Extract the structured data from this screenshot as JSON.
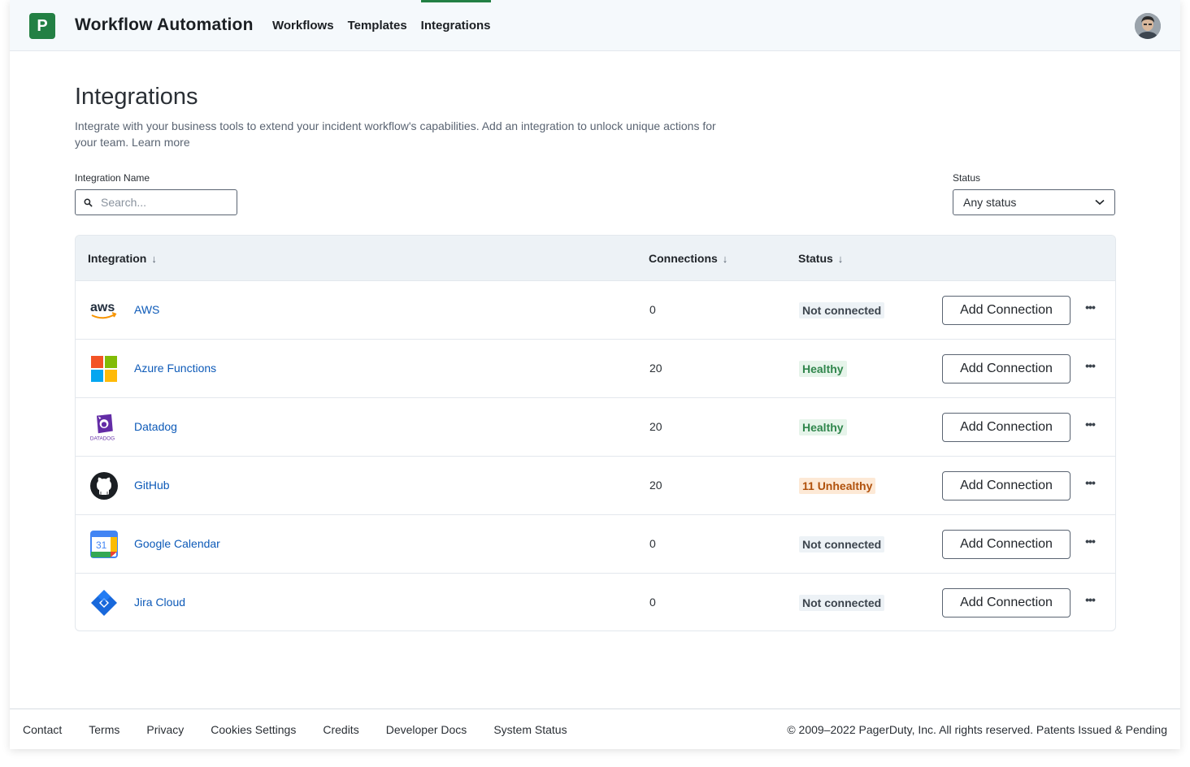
{
  "header": {
    "logo_letter": "P",
    "app_title": "Workflow Automation",
    "nav": [
      {
        "label": "Workflows",
        "active": false
      },
      {
        "label": "Templates",
        "active": false
      },
      {
        "label": "Integrations",
        "active": true
      }
    ]
  },
  "page": {
    "title": "Integrations",
    "description": "Integrate with your business tools to extend your incident workflow's capabilities. Add an integration to unlock unique actions for your team. Learn more"
  },
  "filters": {
    "name_label": "Integration Name",
    "search_placeholder": "Search...",
    "status_label": "Status",
    "status_value": "Any status"
  },
  "table": {
    "headers": {
      "integration": "Integration",
      "connections": "Connections",
      "status": "Status"
    },
    "rows": [
      {
        "name": "AWS",
        "icon": "aws-logo-icon",
        "connections": "0",
        "status": "Not connected",
        "status_type": "not-connected",
        "action": "Add Connection"
      },
      {
        "name": "Azure Functions",
        "icon": "microsoft-logo-icon",
        "connections": "20",
        "status": "Healthy",
        "status_type": "healthy",
        "action": "Add Connection"
      },
      {
        "name": "Datadog",
        "icon": "datadog-logo-icon",
        "connections": "20",
        "status": "Healthy",
        "status_type": "healthy",
        "action": "Add Connection"
      },
      {
        "name": "GitHub",
        "icon": "github-logo-icon",
        "connections": "20",
        "status": "11 Unhealthy",
        "status_type": "unhealthy",
        "action": "Add Connection"
      },
      {
        "name": "Google Calendar",
        "icon": "google-calendar-logo-icon",
        "connections": "0",
        "status": "Not connected",
        "status_type": "not-connected",
        "action": "Add Connection"
      },
      {
        "name": "Jira Cloud",
        "icon": "jira-logo-icon",
        "connections": "0",
        "status": "Not connected",
        "status_type": "not-connected",
        "action": "Add Connection"
      }
    ]
  },
  "footer": {
    "links": [
      "Contact",
      "Terms",
      "Privacy",
      "Cookies Settings",
      "Credits",
      "Developer Docs",
      "System Status"
    ],
    "copyright": "© 2009–2022 PagerDuty, Inc. All rights reserved. Patents Issued & Pending"
  },
  "colors": {
    "brand": "#238044",
    "link": "#0d5ab8",
    "healthy_bg": "#e6f4ea",
    "unhealthy_bg": "#fde9d6"
  }
}
